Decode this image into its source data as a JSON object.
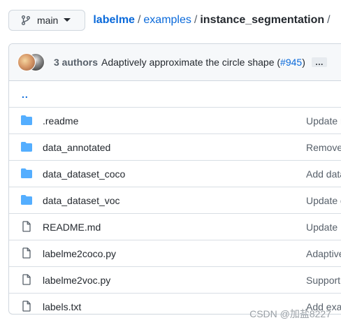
{
  "branch": {
    "label": "main"
  },
  "breadcrumb": {
    "repo": "labelme",
    "sep1": "/",
    "folder": "examples",
    "sep2": "/",
    "current": "instance_segmentation",
    "sep3": "/"
  },
  "commit": {
    "authors": "3 authors",
    "message": "Adaptively approximate the circle shape (",
    "pr": "#945",
    "close": ")",
    "more": "…"
  },
  "parent_dir": "..",
  "files": [
    {
      "name": ".readme",
      "type": "folder",
      "commit": "Update r"
    },
    {
      "name": "data_annotated",
      "type": "folder",
      "commit": "Remove"
    },
    {
      "name": "data_dataset_coco",
      "type": "folder",
      "commit": "Add data"
    },
    {
      "name": "data_dataset_voc",
      "type": "folder",
      "commit": "Update d"
    },
    {
      "name": "README.md",
      "type": "file",
      "commit": "Update R"
    },
    {
      "name": "labelme2coco.py",
      "type": "file",
      "commit": "Adaptive"
    },
    {
      "name": "labelme2voc.py",
      "type": "file",
      "commit": "Support"
    },
    {
      "name": "labels.txt",
      "type": "file",
      "commit": "Add exa"
    }
  ],
  "watermark": "CSDN @加盐8227",
  "colors": {
    "folder": "#54aeff",
    "link": "#0969da",
    "file_icon": "#57606a"
  }
}
